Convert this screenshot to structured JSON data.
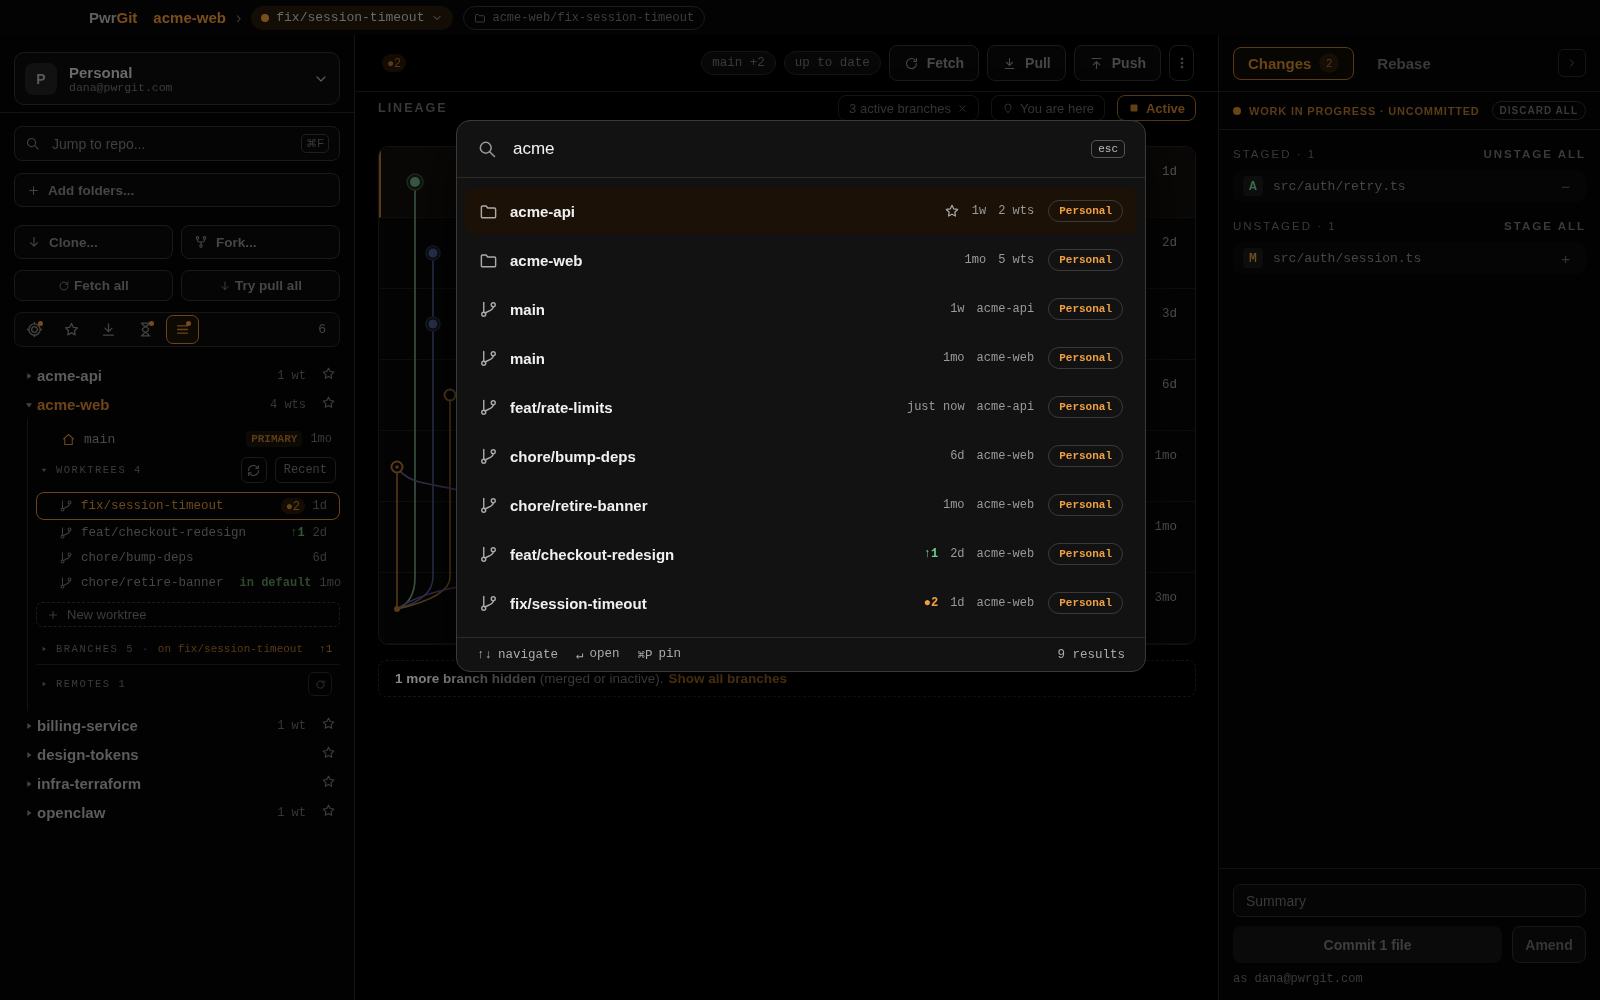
{
  "topbar": {
    "logo": [
      "Pwr",
      "Git"
    ],
    "repo": "acme-web",
    "separator": "›",
    "branch": {
      "name": "fix/session-timeout",
      "dirty": true
    },
    "path": "acme-web/fix-session-timeout"
  },
  "sidebar": {
    "account": {
      "initial": "P",
      "name": "Personal",
      "email": "dana@pwrgit.com"
    },
    "search": {
      "placeholder": "Jump to repo...",
      "shortcut": "⌘F"
    },
    "add_folders": "Add folders...",
    "clone": "Clone...",
    "fork": "Fork...",
    "fetch_all": "Fetch all",
    "try_pull_all": "Try pull all",
    "filters": [
      {
        "kind": "target",
        "dot": true,
        "selected": false
      },
      {
        "kind": "star",
        "dot": false,
        "selected": false
      },
      {
        "kind": "download",
        "dot": false,
        "selected": false
      },
      {
        "kind": "hourglass",
        "dot": true,
        "selected": false
      },
      {
        "kind": "list",
        "dot": true,
        "selected": true
      }
    ],
    "filter_count": "6",
    "repos": [
      {
        "name": "acme-api",
        "count": "1 wt",
        "expanded": false,
        "selected": false
      },
      {
        "name": "acme-web",
        "count": "4 wts",
        "expanded": true,
        "selected": true,
        "primary": {
          "name": "main",
          "badge": "PRIMARY",
          "age": "1mo"
        },
        "worktrees": {
          "title": "WORKTREES",
          "count": "4",
          "sort": "Recent",
          "items": [
            {
              "name": "fix/session-timeout",
              "dirty": "●2",
              "age": "1d",
              "selected": true
            },
            {
              "name": "feat/checkout-redesign",
              "ahead": "↑1",
              "age": "2d",
              "selected": false
            },
            {
              "name": "chore/bump-deps",
              "age": "6d",
              "selected": false
            },
            {
              "name": "chore/retire-banner",
              "note": "in default",
              "age": "1mo",
              "selected": false
            }
          ],
          "new_label": "New worktree"
        },
        "branches": {
          "title": "BRANCHES",
          "count": "5",
          "separator": "·",
          "current": "on fix/session-timeout",
          "ahead": "↑1"
        },
        "remotes": {
          "title": "REMOTES",
          "count": "1"
        }
      },
      {
        "name": "billing-service",
        "count": "1 wt",
        "expanded": false,
        "selected": false
      },
      {
        "name": "design-tokens",
        "expanded": false,
        "selected": false
      },
      {
        "name": "infra-terraform",
        "expanded": false,
        "selected": false
      },
      {
        "name": "openclaw",
        "count": "1 wt",
        "expanded": false,
        "selected": false
      }
    ]
  },
  "center": {
    "toolbar": {
      "dirty": "●2",
      "chips": [
        "main +2",
        "up to date"
      ],
      "buttons": [
        {
          "kind": "fetch",
          "label": "Fetch"
        },
        {
          "kind": "pull",
          "label": "Pull"
        },
        {
          "kind": "push",
          "label": "Push"
        }
      ]
    },
    "lineage": {
      "title": "LINEAGE",
      "filters": [
        {
          "kind": "dismiss",
          "label": "3 active branches",
          "selected": false
        },
        {
          "kind": "location",
          "label": "You are here",
          "selected": false
        },
        {
          "kind": "status",
          "label": "Active",
          "selected": true
        }
      ],
      "rows": [
        {
          "age": "1d",
          "current": true
        },
        {
          "age": "2d",
          "current": false
        },
        {
          "age": "3d",
          "current": false
        },
        {
          "age": "6d",
          "current": false
        },
        {
          "age": "1mo",
          "current": false
        },
        {
          "age": "1mo",
          "current": false
        },
        {
          "age": "3mo",
          "current": false
        }
      ]
    },
    "notice": {
      "text": "**1 more branch hidden** (merged or inactive).",
      "link": "Show all branches"
    }
  },
  "right": {
    "tabs": [
      {
        "label": "Changes",
        "count": "2",
        "selected": true
      },
      {
        "label": "Rebase",
        "selected": false
      }
    ],
    "wip": {
      "label": "WORK IN PROGRESS · UNCOMMITTED",
      "action": "DISCARD ALL"
    },
    "groups": [
      {
        "title": "STAGED · 1",
        "action": "UNSTAGE ALL",
        "files": [
          {
            "status": "A",
            "color": "#3a6a48",
            "path": "src/auth/retry.ts",
            "action": "−"
          }
        ]
      },
      {
        "title": "UNSTAGED · 1",
        "action": "STAGE ALL",
        "files": [
          {
            "status": "M",
            "color": "#6b4f22",
            "path": "src/auth/session.ts",
            "action": "+"
          }
        ]
      }
    ],
    "commit": {
      "placeholder": "Summary",
      "button": "Commit 1 file",
      "amend": "Amend",
      "author": "as dana@pwrgit.com"
    }
  },
  "palette": {
    "query": "acme",
    "esc": "esc",
    "results": [
      {
        "kind": "repo",
        "name": "acme-api",
        "age": "1w",
        "meta": "2 wts",
        "scope": "Personal",
        "selected": true
      },
      {
        "kind": "repo",
        "name": "acme-web",
        "age": "1mo",
        "meta": "5 wts",
        "scope": "Personal",
        "selected": false
      },
      {
        "kind": "branch",
        "name": "main",
        "age": "1w",
        "meta": "acme-api",
        "scope": "Personal",
        "selected": false
      },
      {
        "kind": "branch",
        "name": "main",
        "age": "1mo",
        "meta": "acme-web",
        "scope": "Personal",
        "selected": false
      },
      {
        "kind": "branch",
        "name": "feat/rate-limits",
        "age": "just now",
        "meta": "acme-api",
        "scope": "Personal",
        "selected": false
      },
      {
        "kind": "branch",
        "name": "chore/bump-deps",
        "age": "6d",
        "meta": "acme-web",
        "scope": "Personal",
        "selected": false
      },
      {
        "kind": "branch",
        "name": "chore/retire-banner",
        "age": "1mo",
        "meta": "acme-web",
        "scope": "Personal",
        "selected": false
      },
      {
        "kind": "branch",
        "name": "feat/checkout-redesign",
        "ahead": "↑1",
        "age": "2d",
        "meta": "acme-web",
        "scope": "Personal",
        "selected": false
      },
      {
        "kind": "branch",
        "name": "fix/session-timeout",
        "dirty": "●2",
        "age": "1d",
        "meta": "acme-web",
        "scope": "Personal",
        "selected": false
      }
    ],
    "hints": [
      {
        "keys": "↑↓",
        "label": "navigate"
      },
      {
        "keys": "↵",
        "label": "open"
      },
      {
        "keys": "⌘P",
        "label": "pin"
      }
    ],
    "count": "9 results"
  }
}
